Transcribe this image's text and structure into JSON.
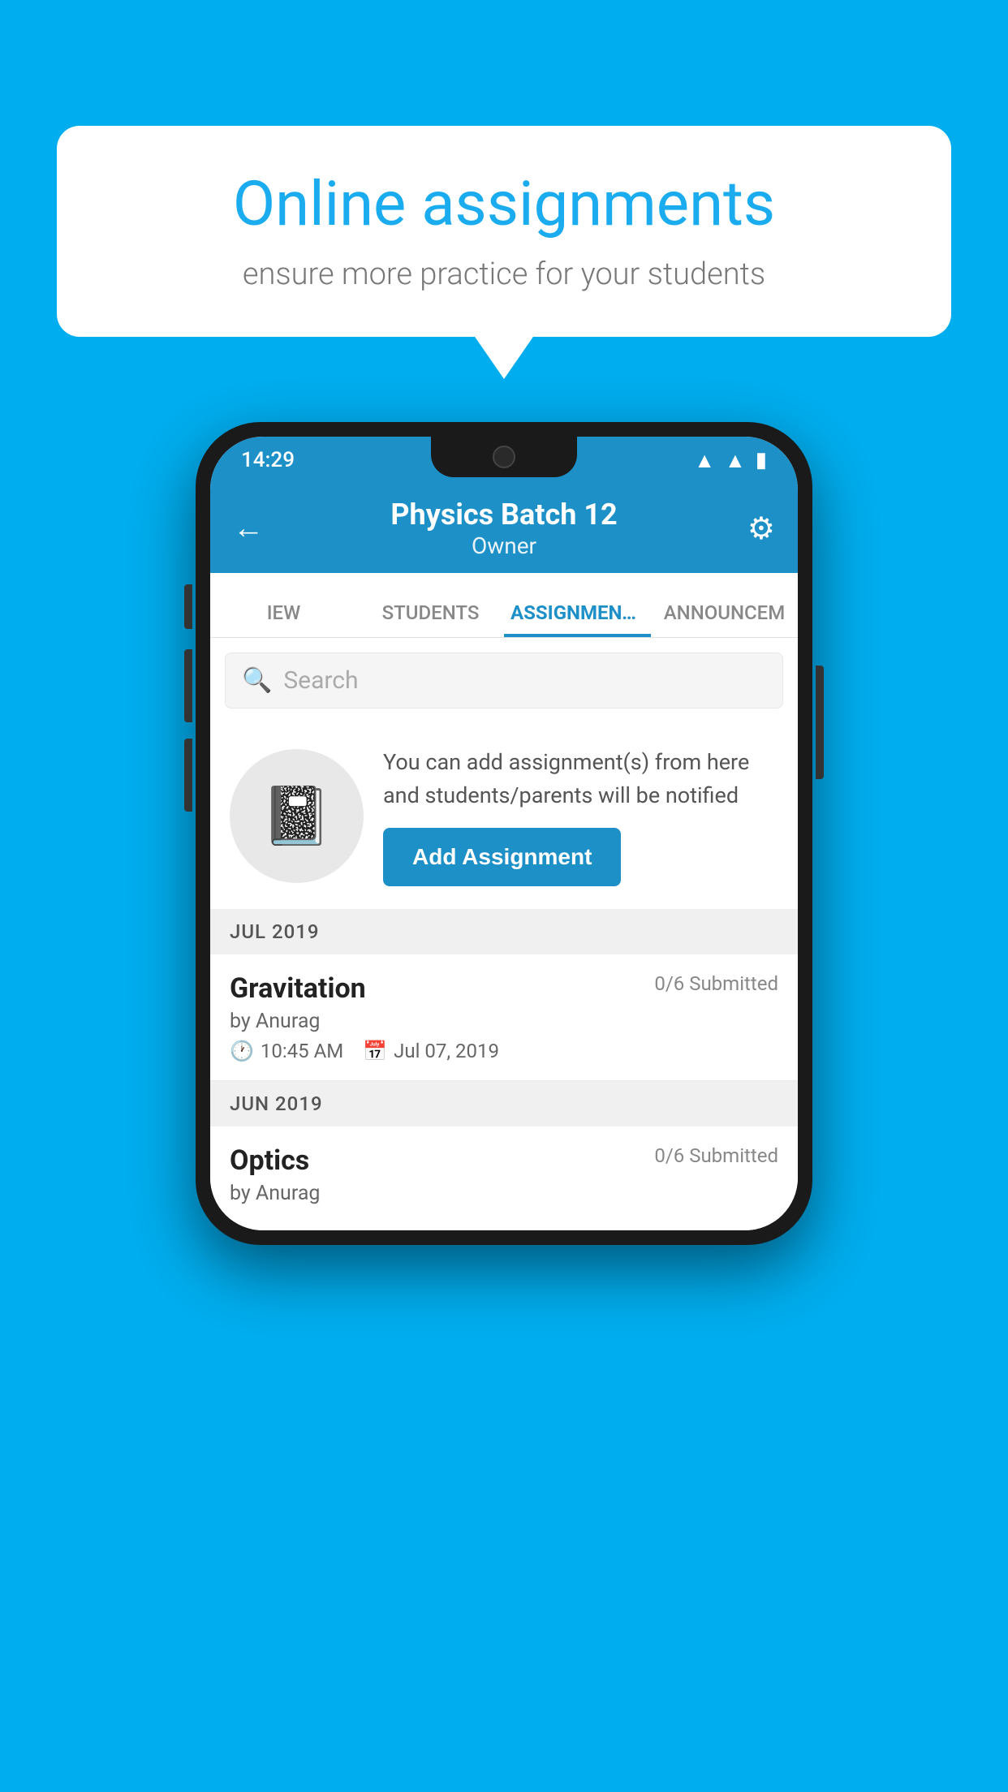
{
  "background": {
    "color": "#00AEEF"
  },
  "speech_bubble": {
    "title": "Online assignments",
    "subtitle": "ensure more practice for your students"
  },
  "phone": {
    "status_bar": {
      "time": "14:29",
      "icons": [
        "wifi",
        "signal",
        "battery"
      ]
    },
    "top_bar": {
      "title": "Physics Batch 12",
      "subtitle": "Owner",
      "back_label": "←",
      "settings_label": "⚙"
    },
    "tabs": [
      {
        "label": "IEW",
        "active": false
      },
      {
        "label": "STUDENTS",
        "active": false
      },
      {
        "label": "ASSIGNMENTS",
        "active": true
      },
      {
        "label": "ANNOUNCEM...",
        "active": false
      }
    ],
    "search": {
      "placeholder": "Search"
    },
    "promo": {
      "text": "You can add assignment(s) from here and students/parents will be notified",
      "button_label": "Add Assignment"
    },
    "sections": [
      {
        "header": "JUL 2019",
        "assignments": [
          {
            "name": "Gravitation",
            "submitted": "0/6 Submitted",
            "by": "by Anurag",
            "time": "10:45 AM",
            "date": "Jul 07, 2019"
          }
        ]
      },
      {
        "header": "JUN 2019",
        "assignments": [
          {
            "name": "Optics",
            "submitted": "0/6 Submitted",
            "by": "by Anurag",
            "time": "",
            "date": ""
          }
        ]
      }
    ]
  }
}
